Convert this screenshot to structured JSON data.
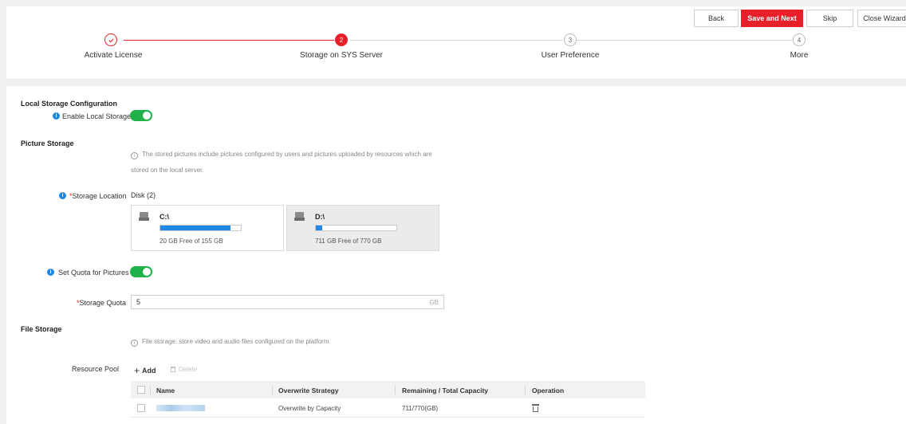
{
  "toolbar": {
    "back_label": "Back",
    "save_next_label": "Save and Next",
    "skip_label": "Skip",
    "close_label": "Close Wizard"
  },
  "steps": [
    {
      "number": "",
      "label": "Activate License",
      "status": "done"
    },
    {
      "number": "2",
      "label": "Storage on SYS Server",
      "status": "active"
    },
    {
      "number": "3",
      "label": "User Preference",
      "status": "todo"
    },
    {
      "number": "4",
      "label": "More",
      "status": "todo"
    }
  ],
  "local_storage": {
    "section_title": "Local Storage Configuration",
    "enable_label": "Enable Local Storage",
    "enabled": true
  },
  "picture_storage": {
    "section_title": "Picture Storage",
    "hint_line1": "The stored pictures include pictures configured by users and pictures uploaded by resources which are",
    "hint_line2": "stored on the local server.",
    "location_label": "Storage Location",
    "disk_count_label": "Disk (2)",
    "disks": [
      {
        "name": "C:\\",
        "free_text": "20 GB Free of 155 GB",
        "used_fraction": 0.87,
        "selected": false
      },
      {
        "name": "D:\\",
        "free_text": "711 GB Free of 770 GB",
        "used_fraction": 0.077,
        "selected": true
      }
    ],
    "quota_toggle_label": "Set Quota for Pictures",
    "quota_enabled": true,
    "quota_label": "Storage Quota",
    "quota_value": "5",
    "quota_unit": "GB"
  },
  "file_storage": {
    "section_title": "File Storage",
    "hint": "File storage: store video and audio files configured on the platform.",
    "resource_pool_label": "Resource Pool",
    "add_label": "Add",
    "delete_label": "Delete",
    "columns": [
      "Name",
      "Overwrite Strategy",
      "Remaining / Total Capacity",
      "Operation"
    ],
    "rows": [
      {
        "name": "",
        "strategy": "Overwrite by Capacity",
        "capacity": "711/770(GB)"
      }
    ]
  },
  "colors": {
    "accent": "#e8202a",
    "toggle_on": "#21b14a",
    "info": "#1e88e5",
    "disk_fill": "#1e88e5"
  },
  "icons": [
    "check-icon",
    "info-icon",
    "disk-icon",
    "plus-icon",
    "trash-icon"
  ]
}
